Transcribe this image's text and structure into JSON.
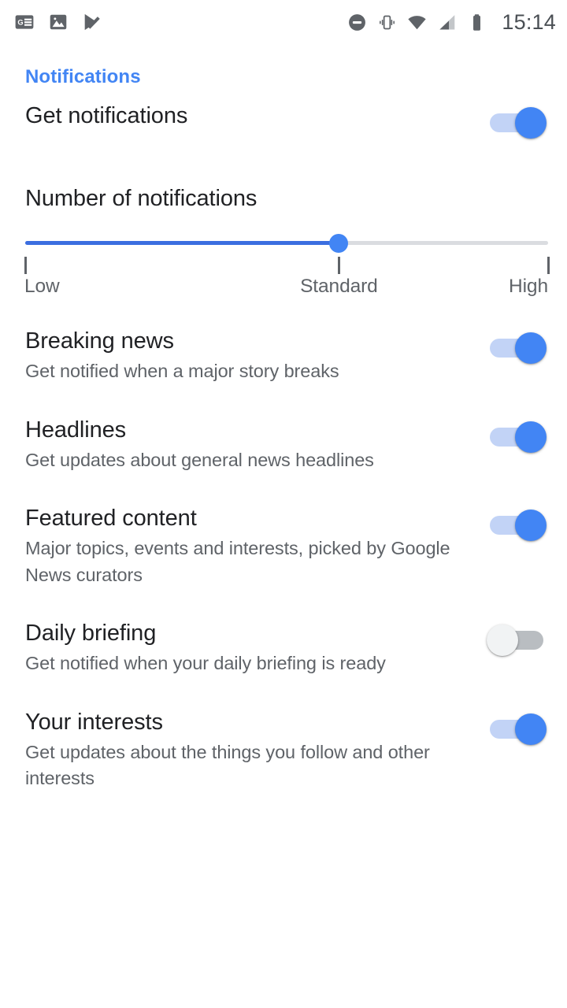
{
  "status_bar": {
    "left_icons": [
      {
        "name": "google-news-icon",
        "label": "Google News"
      },
      {
        "name": "image-icon",
        "label": "Screenshot"
      },
      {
        "name": "play-store-check-icon",
        "label": "Play Store update"
      }
    ],
    "right_icons": [
      {
        "name": "do-not-disturb-icon",
        "label": "Do not disturb"
      },
      {
        "name": "vibrate-icon",
        "label": "Vibrate"
      },
      {
        "name": "wifi-icon",
        "label": "Wi-Fi"
      },
      {
        "name": "cellular-signal-icon",
        "label": "Cellular signal"
      },
      {
        "name": "battery-icon",
        "label": "Battery"
      }
    ],
    "clock": "15:14"
  },
  "section": {
    "header": "Notifications"
  },
  "colors": {
    "accent": "#4285f4",
    "accent_track": "#c2d3f6",
    "slider_fill": "#3b6ee0",
    "slider_track": "#dadce0",
    "title_text": "#202124",
    "secondary_text": "#5f6368",
    "toggle_off_track": "#b9bdc1",
    "toggle_off_thumb": "#f1f3f4",
    "background": "#ffffff"
  },
  "master_toggle": {
    "title": "Get notifications",
    "state": "on"
  },
  "slider": {
    "title": "Number of notifications",
    "value": "Standard",
    "value_index": 1,
    "fill_percent": 60,
    "ticks": [
      {
        "label": "Low",
        "position_percent": 0
      },
      {
        "label": "Standard",
        "position_percent": 60
      },
      {
        "label": "High",
        "position_percent": 100
      }
    ]
  },
  "items": [
    {
      "title": "Breaking news",
      "subtitle": "Get notified when a major story breaks",
      "state": "on"
    },
    {
      "title": "Headlines",
      "subtitle": "Get updates about general news headlines",
      "state": "on"
    },
    {
      "title": "Featured content",
      "subtitle": "Major topics, events and interests, picked by Google News curators",
      "state": "on"
    },
    {
      "title": "Daily briefing",
      "subtitle": "Get notified when your daily briefing is ready",
      "state": "off"
    },
    {
      "title": "Your interests",
      "subtitle": "Get updates about the things you follow and other interests",
      "state": "on"
    }
  ]
}
